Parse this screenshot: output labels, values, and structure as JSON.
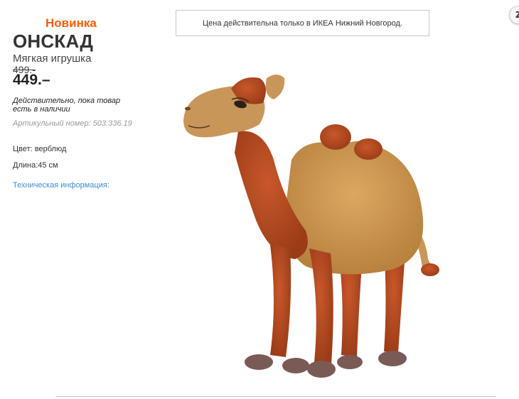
{
  "product": {
    "badge": "Новинка",
    "name": "ОНСКАД",
    "subtitle": "Мягкая игрушка",
    "old_price": "499.-",
    "new_price": "449.–",
    "availability_note": "Действительно, пока товар есть в наличии",
    "article_label": "Артикульный номер: 503.336.19",
    "color_line": "Цвет: верблюд",
    "length_line": "Длина:45 см",
    "tech_info_link": "Техническая информация:"
  },
  "notice": {
    "text": "Цена действительна только в ИКЕА Нижний Новгород."
  },
  "corner_button": {
    "label": "Z"
  },
  "colors": {
    "badge": "#ff5a00",
    "link": "#3a8fd6",
    "camel_body": "#c8954c",
    "camel_fur": "#b24a1e",
    "hoof": "#7a5a55"
  }
}
